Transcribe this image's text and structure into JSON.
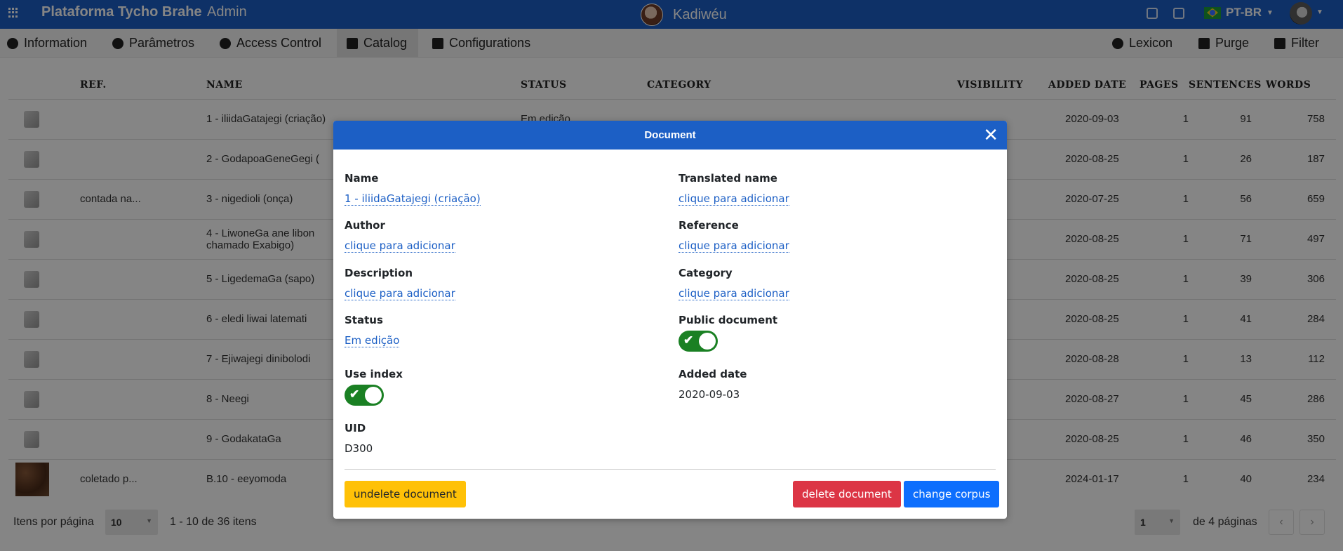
{
  "app": {
    "brand": "Plataforma Tycho Brahe",
    "section": "Admin",
    "corpus": "Kadiwéu",
    "language": "PT-BR"
  },
  "menu": {
    "left": [
      {
        "label": "Information",
        "icon": "info-circle-icon"
      },
      {
        "label": "Parâmetros",
        "icon": "gears-icon"
      },
      {
        "label": "Access Control",
        "icon": "users-icon"
      },
      {
        "label": "Catalog",
        "icon": "book-open-icon",
        "active": true
      },
      {
        "label": "Configurations",
        "icon": "tools-icon"
      }
    ],
    "right": [
      {
        "label": "Lexicon",
        "icon": "gears-icon"
      },
      {
        "label": "Purge",
        "icon": "trash-icon"
      },
      {
        "label": "Filter",
        "icon": "filter-icon"
      }
    ]
  },
  "table": {
    "headers": [
      "",
      "REF.",
      "NAME",
      "STATUS",
      "CATEGORY",
      "VISIBILITY",
      "ADDED DATE",
      "PAGES",
      "SENTENCES",
      "WORDS"
    ],
    "rows": [
      {
        "ref": "",
        "name": "1 - iliidaGatajegi (criação)",
        "status": "Em edição",
        "date": "2020-09-03",
        "pages": "1",
        "sentences": "91",
        "words": "758"
      },
      {
        "ref": "",
        "name": "2 - GodapoaGeneGegi (",
        "status": "",
        "date": "2020-08-25",
        "pages": "1",
        "sentences": "26",
        "words": "187"
      },
      {
        "ref": "contada na...",
        "name": "3 - nigedioli (onça)",
        "status": "",
        "date": "2020-07-25",
        "pages": "1",
        "sentences": "56",
        "words": "659"
      },
      {
        "ref": "",
        "name": "4 - LiwoneGa ane libon",
        "name2": "chamado Exabigo)",
        "status": "",
        "date": "2020-08-25",
        "pages": "1",
        "sentences": "71",
        "words": "497"
      },
      {
        "ref": "",
        "name": "5 - LigedemaGa (sapo)",
        "status": "",
        "date": "2020-08-25",
        "pages": "1",
        "sentences": "39",
        "words": "306"
      },
      {
        "ref": "",
        "name": "6 - eledi liwai latemati",
        "status": "",
        "date": "2020-08-25",
        "pages": "1",
        "sentences": "41",
        "words": "284"
      },
      {
        "ref": "",
        "name": "7 - Ejiwajegi dinibolodi",
        "status": "",
        "date": "2020-08-28",
        "pages": "1",
        "sentences": "13",
        "words": "112"
      },
      {
        "ref": "",
        "name": "8 - Neegi",
        "status": "",
        "date": "2020-08-27",
        "pages": "1",
        "sentences": "45",
        "words": "286"
      },
      {
        "ref": "",
        "name": "9 - GodakataGa",
        "status": "",
        "date": "2020-08-25",
        "pages": "1",
        "sentences": "46",
        "words": "350"
      },
      {
        "ref": "coletado p...",
        "name": "B.10 - eeyomoda",
        "status": "",
        "date": "2024-01-17",
        "pages": "1",
        "sentences": "40",
        "words": "234"
      }
    ]
  },
  "footer": {
    "per_page_label": "Itens por página",
    "per_page": "10",
    "range": "1 - 10 de 36 itens",
    "page": "1",
    "of_pages": "de 4 páginas"
  },
  "modal": {
    "title": "Document",
    "name_label": "Name",
    "name_value": "1 - iliidaGatajegi (criação)",
    "translated_label": "Translated name",
    "translated_value": "clique para adicionar",
    "author_label": "Author",
    "author_value": "clique para adicionar",
    "reference_label": "Reference",
    "reference_value": "clique para adicionar",
    "description_label": "Description",
    "description_value": "clique para adicionar",
    "category_label": "Category",
    "category_value": "clique para adicionar",
    "status_label": "Status",
    "status_value": "Em edição",
    "public_label": "Public document",
    "public_on": true,
    "use_index_label": "Use index",
    "use_index_on": true,
    "added_label": "Added date",
    "added_value": "2020-09-03",
    "uid_label": "UID",
    "uid_value": "D300",
    "undelete_label": "undelete document",
    "delete_label": "delete document",
    "change_corpus_label": "change corpus"
  }
}
